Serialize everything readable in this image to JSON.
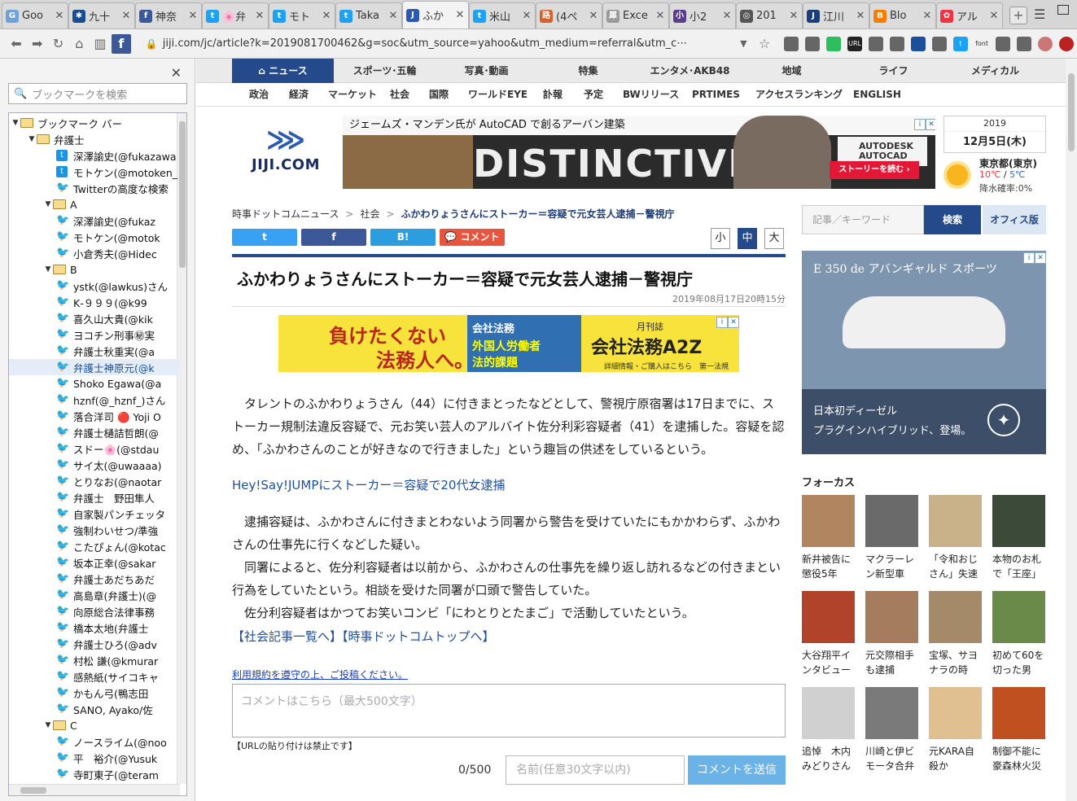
{
  "tabs": [
    {
      "title": "Goo",
      "color": "#6fa3d8",
      "glyph": "G"
    },
    {
      "title": "九十",
      "color": "#1a4d8f",
      "glyph": "✱"
    },
    {
      "title": "神奈",
      "color": "#3b5998",
      "glyph": "f"
    },
    {
      "title": "🌸弁",
      "color": "#1da1f2",
      "glyph": "t"
    },
    {
      "title": "モト",
      "color": "#1da1f2",
      "glyph": "t"
    },
    {
      "title": "Taka",
      "color": "#1da1f2",
      "glyph": "t"
    },
    {
      "title": "ふか",
      "color": "#2a5bb0",
      "glyph": "J",
      "active": true
    },
    {
      "title": "米山",
      "color": "#1da1f2",
      "glyph": "t"
    },
    {
      "title": "(4ペ",
      "color": "#d8602b",
      "glyph": "路"
    },
    {
      "title": "Exce",
      "color": "#999",
      "glyph": "犀"
    },
    {
      "title": "小2",
      "color": "#5b3d8a",
      "glyph": "小"
    },
    {
      "title": "201",
      "color": "#555",
      "glyph": "◎"
    },
    {
      "title": "江川",
      "color": "#1c3e7a",
      "glyph": "J"
    },
    {
      "title": "Blo",
      "color": "#f57d00",
      "glyph": "B"
    },
    {
      "title": "アル",
      "color": "#e34",
      "glyph": "✿"
    }
  ],
  "url": "jiji.com/jc/article?k=2019081700462&g=soc&utm_source=yahoo&utm_medium=referral&utm_c⋯",
  "sidebar": {
    "search_placeholder": "ブックマークを検索",
    "rows": [
      {
        "label": "ブックマーク バー",
        "type": "folder",
        "indent": 0,
        "open": true
      },
      {
        "label": "弁護士",
        "type": "folder",
        "indent": 1,
        "open": true
      },
      {
        "label": "深澤諭史(@fukazawa",
        "type": "tb",
        "indent": 3
      },
      {
        "label": "モトケン(@motoken_",
        "type": "tb",
        "indent": 3
      },
      {
        "label": "Twitterの高度な検索",
        "type": "tw",
        "indent": 3
      },
      {
        "label": "A",
        "type": "folder",
        "indent": 2,
        "open": true
      },
      {
        "label": "深澤諭史(@fukaz",
        "type": "tw",
        "indent": 3
      },
      {
        "label": "モトケン(@motok",
        "type": "tw",
        "indent": 3
      },
      {
        "label": "小倉秀夫(@Hidec",
        "type": "tw",
        "indent": 3
      },
      {
        "label": "B",
        "type": "folder",
        "indent": 2,
        "open": true
      },
      {
        "label": "ystk(@lawkus)さん",
        "type": "tw",
        "indent": 3
      },
      {
        "label": "K‐９９９(@k99",
        "type": "tw",
        "indent": 3
      },
      {
        "label": "喜久山大貴(@kik",
        "type": "tw",
        "indent": 3
      },
      {
        "label": "ヨコチン刑事㊙実",
        "type": "tw",
        "indent": 3
      },
      {
        "label": "弁護士秋重実(@a",
        "type": "tw",
        "indent": 3
      },
      {
        "label": "弁護士神原元(@k",
        "type": "tw",
        "indent": 3,
        "selected": true
      },
      {
        "label": "Shoko Egawa(@a",
        "type": "tw",
        "indent": 3
      },
      {
        "label": "hznf(@_hznf_)さん",
        "type": "tw",
        "indent": 3
      },
      {
        "label": "落合洋司 🔴 Yoji O",
        "type": "tw",
        "indent": 3
      },
      {
        "label": "弁護士樋詰哲朗(@",
        "type": "tw",
        "indent": 3
      },
      {
        "label": "スドー🌸(@stdau",
        "type": "tw",
        "indent": 3
      },
      {
        "label": "サイ太(@uwaaaa)",
        "type": "tw",
        "indent": 3
      },
      {
        "label": "とりなお(@naotar",
        "type": "tw",
        "indent": 3
      },
      {
        "label": "弁護士　野田隼人",
        "type": "tw",
        "indent": 3
      },
      {
        "label": "自家製パンチェッタ",
        "type": "tw",
        "indent": 3
      },
      {
        "label": "強制わいせつ/準強",
        "type": "tw",
        "indent": 3
      },
      {
        "label": "こたぴょん(@kotac",
        "type": "tw",
        "indent": 3
      },
      {
        "label": "坂本正幸(@sakar",
        "type": "tw",
        "indent": 3
      },
      {
        "label": "弁護士あだちあだ",
        "type": "tw",
        "indent": 3
      },
      {
        "label": "高島章(弁護士)(@",
        "type": "tw",
        "indent": 3
      },
      {
        "label": "向原総合法律事務",
        "type": "tw",
        "indent": 3
      },
      {
        "label": "橋本太地(弁護士",
        "type": "tw",
        "indent": 3
      },
      {
        "label": "弁護士ひろ(@adv",
        "type": "tw",
        "indent": 3
      },
      {
        "label": "村松 謙(@kmurar",
        "type": "tw",
        "indent": 3
      },
      {
        "label": "感熱紙(サイコキャ",
        "type": "tw",
        "indent": 3
      },
      {
        "label": "かもん弓(鴨志田",
        "type": "tw",
        "indent": 3
      },
      {
        "label": "SANO, Ayako/佐",
        "type": "tw",
        "indent": 3
      },
      {
        "label": "C",
        "type": "folder",
        "indent": 2,
        "open": true
      },
      {
        "label": "ノースライム(@noo",
        "type": "tw",
        "indent": 3
      },
      {
        "label": "平　裕介(@Yusuk",
        "type": "tw",
        "indent": 3
      },
      {
        "label": "寺町東子(@teram",
        "type": "tw",
        "indent": 3
      }
    ]
  },
  "site": {
    "nav1": [
      "ニュース",
      "スポーツ･五輪",
      "写真･動画",
      "特集",
      "エンタメ･AKB48",
      "地域",
      "ライフ",
      "メディカル"
    ],
    "nav2": [
      "政治",
      "経済",
      "マーケット",
      "社会",
      "国際",
      "ワールドEYE",
      "訃報",
      "予定",
      "BWリリース",
      "PRTIMES",
      "アクセスランキング",
      "ENGLISH"
    ],
    "logo": "JIJI.COM",
    "ad_top": {
      "head": "ジェームズ・マンデン氏が AutoCAD で創るアーバン建築",
      "big": "DISTINCTIVE",
      "brand1": "AUTODESK",
      "brand2": "AUTOCAD",
      "cta": "ストーリーを読む ›"
    },
    "date": {
      "year": "2019",
      "day": "12月5日(木)"
    },
    "weather": {
      "loc": "東京都(東京)",
      "high": "10℃",
      "low": "5℃",
      "rain": "降水確率:0%"
    },
    "crumbs": [
      "時事ドットコムニュース",
      "社会",
      "ふかわりょうさんにストーカー＝容疑で元女芸人逮捕－警視庁"
    ],
    "share": {
      "tw": "t",
      "fb": "f",
      "hb": "B!",
      "cm": "コメント"
    },
    "fontsize": [
      "小",
      "中",
      "大"
    ],
    "title": "ふかわりょうさんにストーカー＝容疑で元女芸人逮捕－警視庁",
    "published": "2019年08月17日20時15分",
    "ad_mid": {
      "l1": "負けたくない",
      "l2": "法務人へ。",
      "p1": "会社法務",
      "p2": "外国人労働者",
      "p3": "法的課題",
      "title": "会社法務A2Z",
      "sub": "月刊誌",
      "link": "詳細情報・ご購入はこちら　第一法規"
    },
    "para1": "タレントのふかわりょうさん（44）に付きまとったなどとして、警視庁原宿署は17日までに、ストーカー規制法違反容疑で、元お笑い芸人のアルバイト佐分利彩容疑者（41）を逮捕した。容疑を認め、「ふかわさんのことが好きなので行きました」という趣旨の供述をしているという。",
    "related": "Hey!Say!JUMPにストーカー＝容疑で20代女逮捕",
    "para2": "逮捕容疑は、ふかわさんに付きまとわないよう同署から警告を受けていたにもかかわらず、ふかわさんの仕事先に行くなどした疑い。",
    "para3": "同署によると、佐分利容疑者は以前から、ふかわさんの仕事先を繰り返し訪れるなどの付きまとい行為をしていたという。相談を受けた同署が口頭で警告していた。",
    "para4": "佐分利容疑者はかつてお笑いコンビ「にわとりとたまご」で活動していたという。",
    "links": "【社会記事一覧へ】【時事ドットコムトップへ】",
    "terms": "利用規約を遵守の上、ご投稿ください。",
    "comment_placeholder": "コメントはこちら（最大500文字）",
    "nourl": "【URLの貼り付けは禁止です】",
    "count": "0/500",
    "name_placeholder": "名前(任意30文字以内)",
    "send": "コメントを送信",
    "search_placeholder": "記事／キーワード",
    "search_btn": "検索",
    "office": "オフィス版",
    "ad_side": {
      "head": "E 350 de アバンギャルド スポーツ",
      "l1": "日本初ディーゼル",
      "l2": "プラグインハイブリッド、登場。"
    },
    "focus_title": "フォーカス",
    "focus": [
      {
        "cap": "新井被告に懲役5年",
        "color": "#b08560"
      },
      {
        "cap": "マクラーレン新型車",
        "color": "#6a6a6a"
      },
      {
        "cap": "「令和おじさん」失速",
        "color": "#c9b28a"
      },
      {
        "cap": "本物のお札で「王座」",
        "color": "#3c4a3a"
      },
      {
        "cap": "大谷翔平インタビュー",
        "color": "#b0432a"
      },
      {
        "cap": "元交際相手も逮捕",
        "color": "#a67c5f"
      },
      {
        "cap": "宝塚、サヨナラの時",
        "color": "#a58a6a"
      },
      {
        "cap": "初めて60を切った男",
        "color": "#6a8a4a"
      },
      {
        "cap": "追悼　木内みどりさん",
        "color": "#d0d0d0"
      },
      {
        "cap": "川崎と伊ビモータ合弁",
        "color": "#7a7a7a"
      },
      {
        "cap": "元KARA自殺か",
        "color": "#e0c090"
      },
      {
        "cap": "制御不能に豪森林火災",
        "color": "#c05020"
      }
    ]
  }
}
